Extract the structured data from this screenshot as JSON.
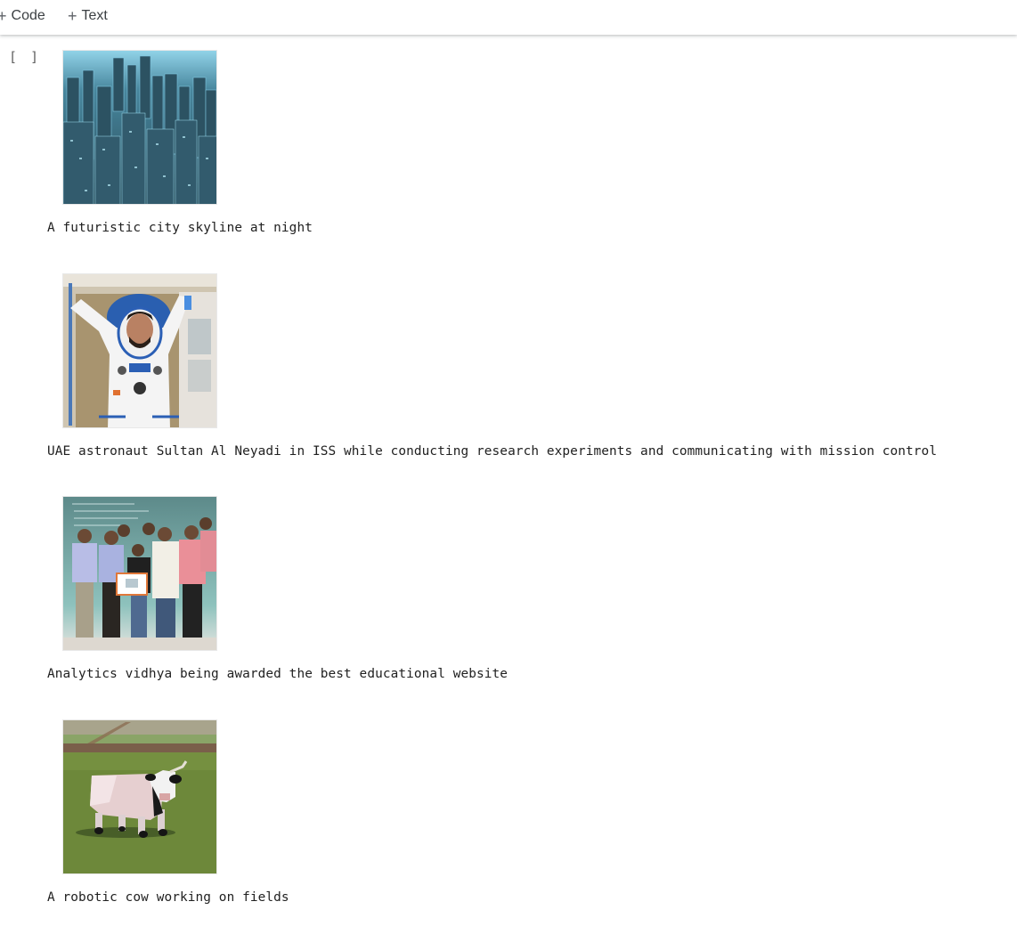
{
  "toolbar": {
    "code_button": {
      "icon": "plus-icon",
      "label": "Code"
    },
    "text_button": {
      "icon": "plus-icon",
      "label": "Text"
    }
  },
  "cell": {
    "execution_indicator": "[ ]",
    "outputs": [
      {
        "image_subject": "futuristic-city-skyline",
        "caption": "A futuristic city skyline at night"
      },
      {
        "image_subject": "astronaut-in-iss",
        "caption": "UAE astronaut Sultan Al Neyadi in ISS while conducting research experiments and communicating with mission control"
      },
      {
        "image_subject": "group-award-photo",
        "caption": "Analytics vidhya being awarded the best educational website"
      },
      {
        "image_subject": "robotic-cow-field",
        "caption": "A robotic cow working on fields"
      }
    ]
  },
  "colors": {
    "city_primary": "#2a5a72",
    "astronaut_suit": "#f2f2f2",
    "group_backdrop": "#7fa7a5",
    "field_green": "#6f8a3c"
  }
}
